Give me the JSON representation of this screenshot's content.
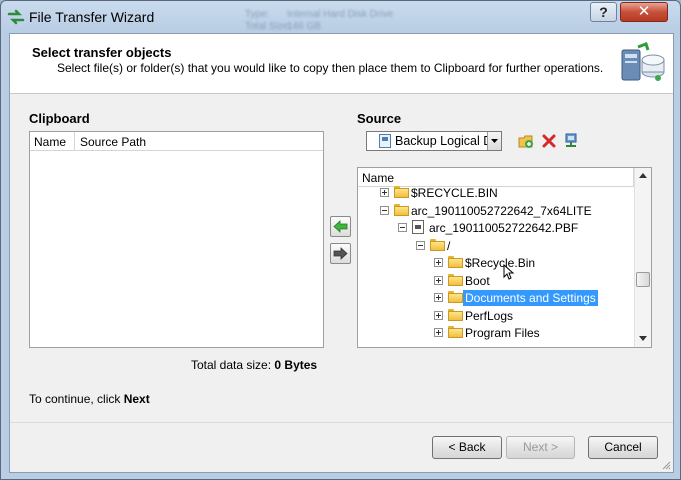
{
  "window": {
    "title": "File Transfer Wizard",
    "ghost_title_left": "Type:",
    "ghost_title_right": "Internal Hard Disk Drive",
    "ghost_sub_left": "Total Size:",
    "ghost_sub_right": "146 GB",
    "help_label": "?",
    "close_label": "✕"
  },
  "header": {
    "title": "Select transfer objects",
    "subtitle": "Select file(s) or folder(s) that you would like to copy then place them to Clipboard for further operations."
  },
  "clipboard": {
    "label": "Clipboard",
    "columns": [
      "Name",
      "Source Path"
    ],
    "total_prefix": "Total data size: ",
    "total_value": "0 Bytes"
  },
  "source": {
    "label": "Source",
    "combo_value": "Backup Logical Drive",
    "tree_header": "Name",
    "rows": [
      {
        "label": "$RECYCLE.BIN",
        "expander": "plus",
        "icon": "folder"
      },
      {
        "label": "arc_190110052722642_7x64LITE",
        "expander": "minus",
        "icon": "folder"
      },
      {
        "label": "arc_190110052722642.PBF",
        "expander": "minus",
        "icon": "file"
      },
      {
        "label": "/",
        "expander": "minus",
        "icon": "folder-open"
      },
      {
        "label": "$Recycle.Bin",
        "expander": "plus",
        "icon": "folder"
      },
      {
        "label": "Boot",
        "expander": "plus",
        "icon": "folder"
      },
      {
        "label": "Documents and Settings",
        "expander": "plus",
        "icon": "folder",
        "selected": true
      },
      {
        "label": "PerfLogs",
        "expander": "plus",
        "icon": "folder"
      },
      {
        "label": "Program Files",
        "expander": "plus",
        "icon": "folder"
      }
    ]
  },
  "footer": {
    "continue_prefix": "To continue, click ",
    "continue_bold": "Next",
    "back_label": "< Back",
    "next_label": "Next >",
    "cancel_label": "Cancel"
  },
  "colors": {
    "selection": "#3399ff",
    "title_bar": "#b9cde4"
  }
}
